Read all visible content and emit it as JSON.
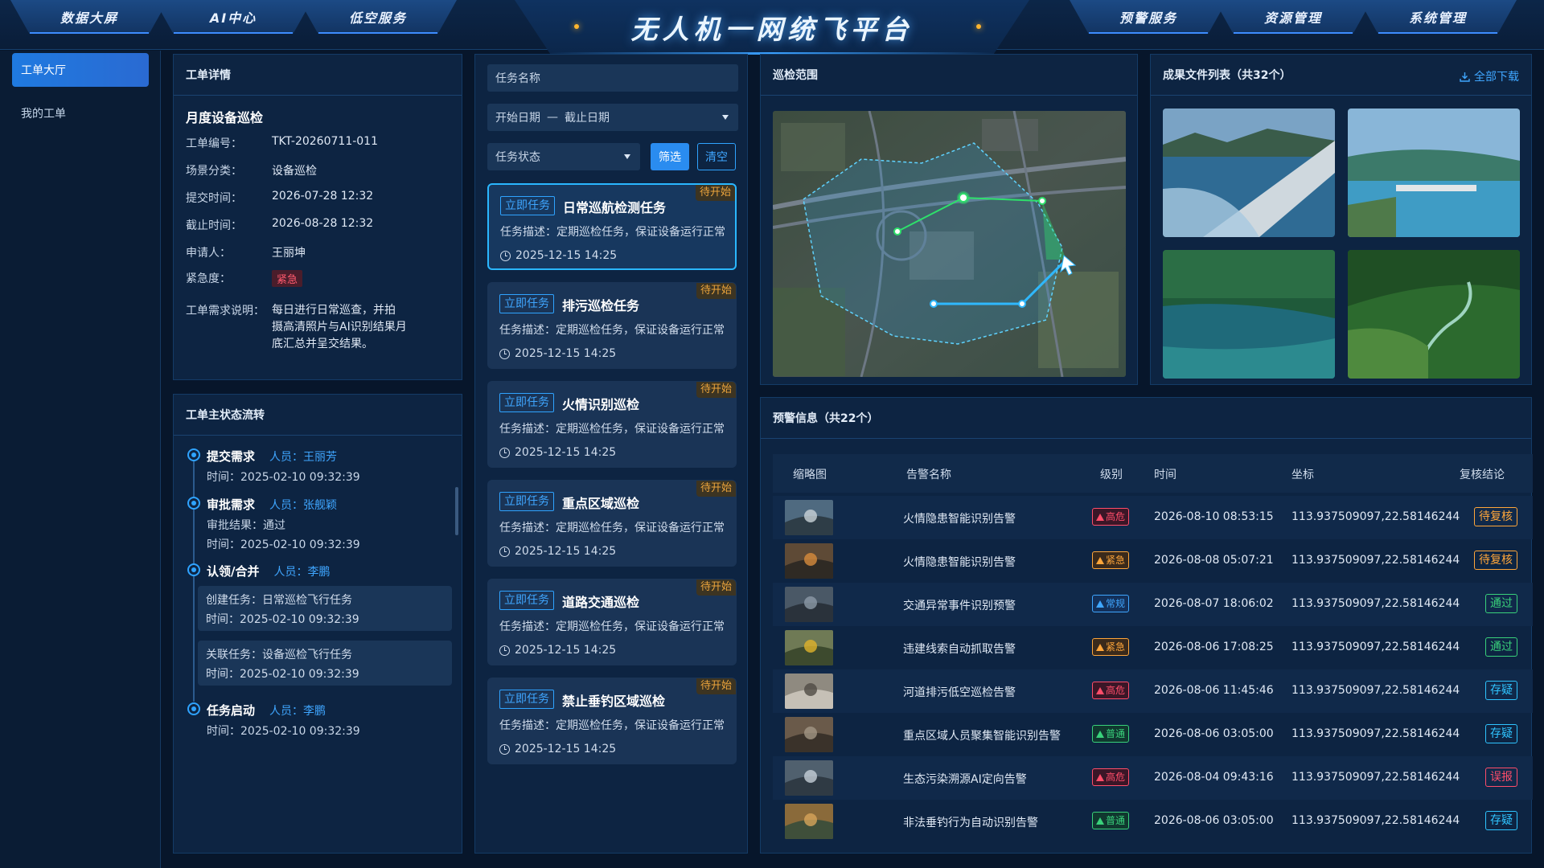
{
  "header": {
    "title": "无人机一网统飞平台",
    "nav_left": [
      "数据大屏",
      "AI中心",
      "低空服务"
    ],
    "nav_right": [
      "预警服务",
      "资源管理",
      "系统管理"
    ]
  },
  "sidebar": {
    "items": [
      {
        "label": "工单大厅",
        "active": true
      },
      {
        "label": "我的工单",
        "active": false
      }
    ]
  },
  "detail": {
    "panel_title": "工单详情",
    "name": "月度设备巡检",
    "fields": [
      {
        "k": "工单编号：",
        "v": "TKT-20260711-011"
      },
      {
        "k": "场景分类：",
        "v": "设备巡检"
      },
      {
        "k": "提交时间：",
        "v": "2026-07-28 12:32"
      },
      {
        "k": "截止时间：",
        "v": "2026-08-28 12:32"
      },
      {
        "k": "申请人：",
        "v": "王丽坤"
      }
    ],
    "urgency_label": "紧急度：",
    "urgency_value": "紧急",
    "desc_label": "工单需求说明：",
    "desc_lines": [
      "每日进行日常巡查，并拍",
      "摄高清照片与AI识别结果月",
      "底汇总并呈交结果。"
    ]
  },
  "flow": {
    "panel_title": "工单主状态流转",
    "steps": [
      {
        "name": "提交需求",
        "person": "人员：王丽芳",
        "lines": [
          "时间：2025-02-10 09:32:39"
        ]
      },
      {
        "name": "审批需求",
        "person": "人员：张舰颖",
        "lines": [
          "审批结果：通过",
          "时间：2025-02-10 09:32:39"
        ]
      },
      {
        "name": "认领/合并",
        "person": "人员：李鹏",
        "boxes": [
          [
            "创建任务：日常巡检飞行任务",
            "时间：2025-02-10 09:32:39"
          ],
          [
            "关联任务：设备巡检飞行任务",
            "时间：2025-02-10 09:32:39"
          ]
        ]
      },
      {
        "name": "任务启动",
        "person": "人员：李鹏",
        "lines": [
          "时间：2025-02-10 09:32:39"
        ]
      }
    ]
  },
  "tasks": {
    "search_placeholder": "任务名称",
    "start_date": "开始日期",
    "date_sep": "—",
    "end_date": "截止日期",
    "status_select": "任务状态",
    "filter_btn": "筛选",
    "clear_btn": "清空",
    "items": [
      {
        "tag": "立即任务",
        "name": "日常巡航检测任务",
        "status": "待开始",
        "desc": "任务描述：定期巡检任务，保证设备运行正常",
        "time": "2025-12-15 14:25",
        "selected": true
      },
      {
        "tag": "立即任务",
        "name": "排污巡检任务",
        "status": "待开始",
        "desc": "任务描述：定期巡检任务，保证设备运行正常",
        "time": "2025-12-15 14:25",
        "selected": false
      },
      {
        "tag": "立即任务",
        "name": "火情识别巡检",
        "status": "待开始",
        "desc": "任务描述：定期巡检任务，保证设备运行正常",
        "time": "2025-12-15 14:25",
        "selected": false
      },
      {
        "tag": "立即任务",
        "name": "重点区域巡检",
        "status": "待开始",
        "desc": "任务描述：定期巡检任务，保证设备运行正常",
        "time": "2025-12-15 14:25",
        "selected": false
      },
      {
        "tag": "立即任务",
        "name": "道路交通巡检",
        "status": "待开始",
        "desc": "任务描述：定期巡检任务，保证设备运行正常",
        "time": "2025-12-15 14:25",
        "selected": false
      },
      {
        "tag": "立即任务",
        "name": "禁止垂钓区域巡检",
        "status": "待开始",
        "desc": "任务描述：定期巡检任务，保证设备运行正常",
        "time": "2025-12-15 14:25",
        "selected": false
      }
    ]
  },
  "map": {
    "panel_title": "巡检范围"
  },
  "files": {
    "panel_title": "成果文件列表（共32个）",
    "download_all": "全部下载"
  },
  "alerts": {
    "panel_title": "预警信息（共22个）",
    "columns": [
      "缩略图",
      "告警名称",
      "级别",
      "时间",
      "坐标",
      "复核结论"
    ],
    "rows": [
      {
        "name": "火情隐患智能识别告警",
        "level": "高危",
        "level_type": "high",
        "time": "2026-08-10 08:53:15",
        "coord": "113.937509097,22.58146244",
        "result": "待复核",
        "result_type": "pending"
      },
      {
        "name": "火情隐患智能识别告警",
        "level": "紧急",
        "level_type": "urgent",
        "time": "2026-08-08 05:07:21",
        "coord": "113.937509097,22.58146244",
        "result": "待复核",
        "result_type": "pending"
      },
      {
        "name": "交通异常事件识别预警",
        "level": "常规",
        "level_type": "normal",
        "time": "2026-08-07 18:06:02",
        "coord": "113.937509097,22.58146244",
        "result": "通过",
        "result_type": "pass"
      },
      {
        "name": "违建线索自动抓取告警",
        "level": "紧急",
        "level_type": "urgent",
        "time": "2026-08-06 17:08:25",
        "coord": "113.937509097,22.58146244",
        "result": "通过",
        "result_type": "pass"
      },
      {
        "name": "河道排污低空巡检告警",
        "level": "高危",
        "level_type": "high",
        "time": "2026-08-06 11:45:46",
        "coord": "113.937509097,22.58146244",
        "result": "存疑",
        "result_type": "doubt"
      },
      {
        "name": "重点区域人员聚集智能识别告警",
        "level": "普通",
        "level_type": "common",
        "time": "2026-08-06 03:05:00",
        "coord": "113.937509097,22.58146244",
        "result": "存疑",
        "result_type": "doubt"
      },
      {
        "name": "生态污染溯源AI定向告警",
        "level": "高危",
        "level_type": "high",
        "time": "2026-08-04 09:43:16",
        "coord": "113.937509097,22.58146244",
        "result": "误报",
        "result_type": "false"
      },
      {
        "name": "非法垂钓行为自动识别告警",
        "level": "普通",
        "level_type": "common",
        "time": "2026-08-06 03:05:00",
        "coord": "113.937509097,22.58146244",
        "result": "存疑",
        "result_type": "doubt"
      }
    ]
  }
}
